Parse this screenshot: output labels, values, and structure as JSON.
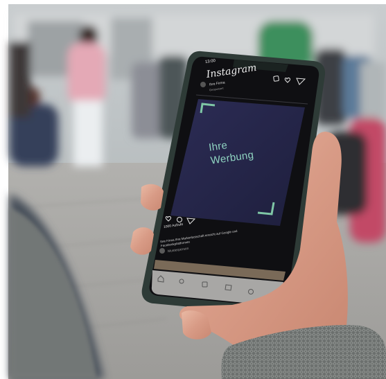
{
  "app": {
    "name": "Instagram",
    "status_time": "13:00"
  },
  "post": {
    "account_name": "Ihre Firma",
    "account_subtitle": "Gesponsert",
    "headline_line1": "Ihre",
    "headline_line2": "Werbung",
    "likes": "1000 Aufrufe",
    "caption": "Ihre Firma Ihre Markenbotschaft erreicht auf Google und Facebookplattformen",
    "comment_placeholder": "Musterperson"
  },
  "colors": {
    "ad_background": "#26264a",
    "ad_text": "#8fd3c0",
    "ad_corner": "#7fc7a6",
    "phone_frame": "#2e3b37",
    "screen_bg": "#0f0f12"
  },
  "icons": [
    "add-icon",
    "heart-icon",
    "send-icon",
    "comment-icon",
    "share-icon",
    "home-icon",
    "search-icon",
    "reels-icon",
    "shop-icon",
    "profile-icon"
  ]
}
